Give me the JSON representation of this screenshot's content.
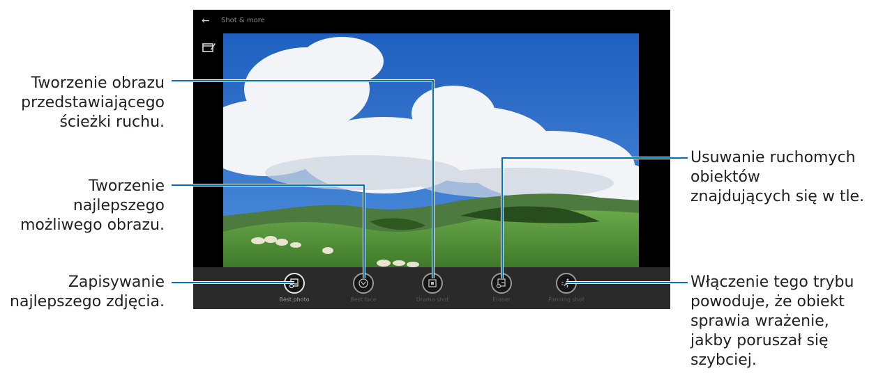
{
  "app": {
    "title": "Shot & more"
  },
  "modes": [
    {
      "label": "Best photo",
      "icon": "best-photo-icon",
      "active": true
    },
    {
      "label": "Best face",
      "icon": "best-face-icon",
      "active": false
    },
    {
      "label": "Drama shot",
      "icon": "drama-shot-icon",
      "active": false
    },
    {
      "label": "Eraser",
      "icon": "eraser-icon",
      "active": false
    },
    {
      "label": "Panning shot",
      "icon": "panning-shot-icon",
      "active": false
    }
  ],
  "annotations": {
    "drama": [
      "Tworzenie obrazu",
      "przedstawiającego",
      "ścieżki ruchu."
    ],
    "best_face": [
      "Tworzenie",
      "najlepszego",
      "możliwego obrazu."
    ],
    "best_photo": [
      "Zapisywanie",
      "najlepszego zdjęcia."
    ],
    "eraser": [
      "Usuwanie ruchomych",
      "obiektów",
      "znajdujących się w tle."
    ],
    "panning": [
      "Włączenie tego trybu",
      "powoduje, że obiekt",
      "sprawia wrażenie,",
      "jakby poruszał się",
      "szybciej."
    ]
  },
  "colors": {
    "leader_line": "#0072bc",
    "text": "#231f20",
    "sky": "#2c6fc8",
    "grass": "#5a9a3a"
  }
}
